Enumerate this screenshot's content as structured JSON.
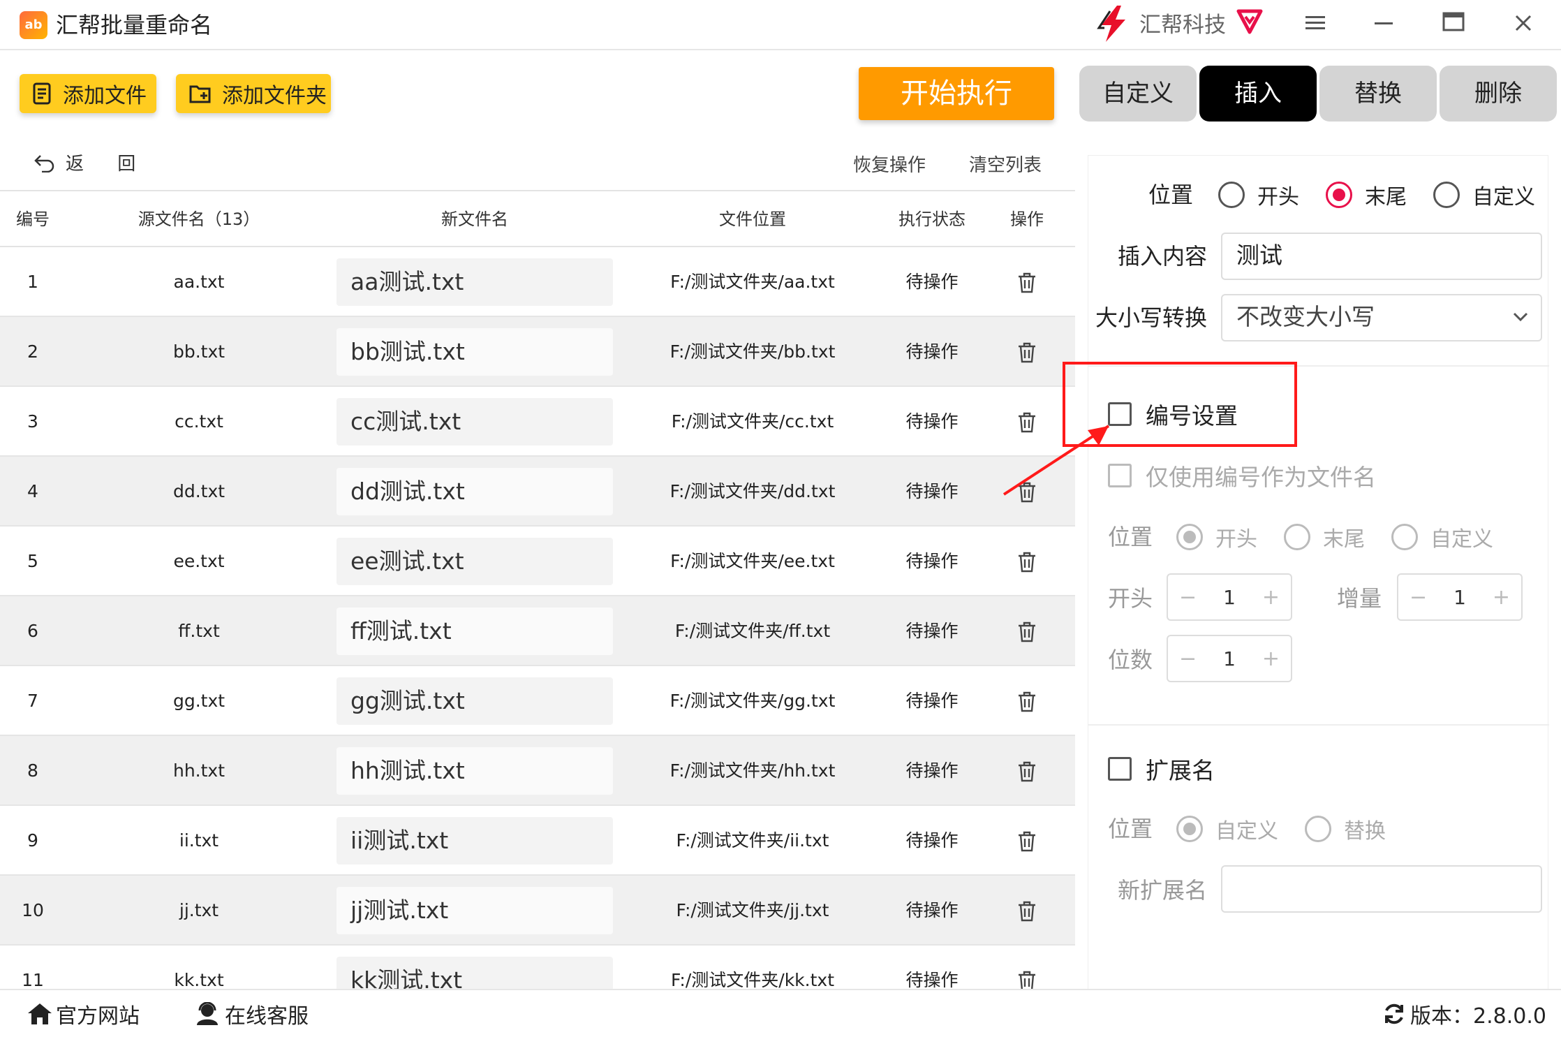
{
  "app": {
    "title": "汇帮批量重命名",
    "logo_text": "ab",
    "brand_name": "汇帮科技"
  },
  "window": {
    "menu_icon": "menu-icon",
    "minimize_icon": "minimize-icon",
    "maximize_icon": "maximize-icon",
    "close_icon": "close-icon"
  },
  "toolbar": {
    "add_file": "添加文件",
    "add_folder": "添加文件夹",
    "start": "开始执行"
  },
  "tabs": [
    {
      "label": "自定义"
    },
    {
      "label": "插入"
    },
    {
      "label": "替换"
    },
    {
      "label": "删除"
    }
  ],
  "subbar": {
    "back": "返 回",
    "restore": "恢复操作",
    "clear": "清空列表"
  },
  "table": {
    "headers": {
      "index": "编号",
      "source": "源文件名（13）",
      "new": "新文件名",
      "location": "文件位置",
      "status": "执行状态",
      "action": "操作"
    },
    "rows": [
      {
        "index": "1",
        "source": "aa.txt",
        "new": "aa测试.txt",
        "location": "F:/测试文件夹/aa.txt",
        "status": "待操作"
      },
      {
        "index": "2",
        "source": "bb.txt",
        "new": "bb测试.txt",
        "location": "F:/测试文件夹/bb.txt",
        "status": "待操作"
      },
      {
        "index": "3",
        "source": "cc.txt",
        "new": "cc测试.txt",
        "location": "F:/测试文件夹/cc.txt",
        "status": "待操作"
      },
      {
        "index": "4",
        "source": "dd.txt",
        "new": "dd测试.txt",
        "location": "F:/测试文件夹/dd.txt",
        "status": "待操作"
      },
      {
        "index": "5",
        "source": "ee.txt",
        "new": "ee测试.txt",
        "location": "F:/测试文件夹/ee.txt",
        "status": "待操作"
      },
      {
        "index": "6",
        "source": "ff.txt",
        "new": "ff测试.txt",
        "location": "F:/测试文件夹/ff.txt",
        "status": "待操作"
      },
      {
        "index": "7",
        "source": "gg.txt",
        "new": "gg测试.txt",
        "location": "F:/测试文件夹/gg.txt",
        "status": "待操作"
      },
      {
        "index": "8",
        "source": "hh.txt",
        "new": "hh测试.txt",
        "location": "F:/测试文件夹/hh.txt",
        "status": "待操作"
      },
      {
        "index": "9",
        "source": "ii.txt",
        "new": "ii测试.txt",
        "location": "F:/测试文件夹/ii.txt",
        "status": "待操作"
      },
      {
        "index": "10",
        "source": "jj.txt",
        "new": "jj测试.txt",
        "location": "F:/测试文件夹/jj.txt",
        "status": "待操作"
      },
      {
        "index": "11",
        "source": "kk.txt",
        "new": "kk测试.txt",
        "location": "F:/测试文件夹/kk.txt",
        "status": "待操作"
      }
    ]
  },
  "insert": {
    "position_label": "位置",
    "position_options": [
      "开头",
      "末尾",
      "自定义"
    ],
    "position_selected": "末尾",
    "content_label": "插入内容",
    "content_value": "测试",
    "case_label": "大小写转换",
    "case_value": "不改变大小写"
  },
  "numbering": {
    "enable_label": "编号设置",
    "only_number_label": "仅使用编号作为文件名",
    "position_label": "位置",
    "position_options": [
      "开头",
      "末尾",
      "自定义"
    ],
    "position_selected": "开头",
    "start_label": "开头",
    "start_value": "1",
    "increment_label": "增量",
    "increment_value": "1",
    "digits_label": "位数",
    "digits_value": "1",
    "minus": "−",
    "plus": "+"
  },
  "extension": {
    "enable_label": "扩展名",
    "position_label": "位置",
    "position_options": [
      "自定义",
      "替换"
    ],
    "position_selected": "自定义",
    "new_ext_label": "新扩展名",
    "new_ext_value": ""
  },
  "footer": {
    "website": "官方网站",
    "support": "在线客服",
    "version": "版本：2.8.0.0"
  },
  "colors": {
    "accent_yellow": "#ffcc1f",
    "start_orange": "#ff9a00",
    "radio_red": "#e8104a",
    "annotation_red": "#ff1a1a"
  }
}
